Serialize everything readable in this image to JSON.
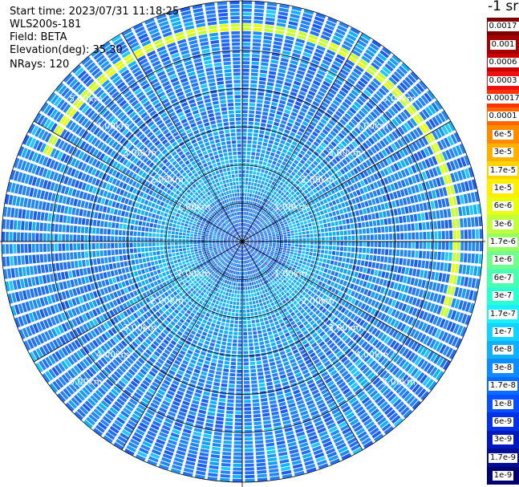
{
  "header": {
    "start_time": "Start time: 2023/07/31 11:18:25",
    "instrument": "WLS200s-181",
    "field": "Field: BETA",
    "elevation": "Elevation(deg): 35.30",
    "nrays": "NRays: 120"
  },
  "colorbar": {
    "unit_label": "-1 sr",
    "entries": [
      {
        "label": "0.0017",
        "color": "#7f0000"
      },
      {
        "label": "0.001",
        "color": "#a50000"
      },
      {
        "label": "0.0006",
        "color": "#cc0000"
      },
      {
        "label": "0.0003",
        "color": "#ee1111"
      },
      {
        "label": "0.00017",
        "color": "#ff3300"
      },
      {
        "label": "0.0001",
        "color": "#ff6600"
      },
      {
        "label": "6e-5",
        "color": "#ff8c00"
      },
      {
        "label": "3e-5",
        "color": "#ffb000"
      },
      {
        "label": "1.7e-5",
        "color": "#ffd400"
      },
      {
        "label": "1e-5",
        "color": "#ffee00"
      },
      {
        "label": "6e-6",
        "color": "#e8ff10"
      },
      {
        "label": "3e-6",
        "color": "#bfff3c"
      },
      {
        "label": "1.7e-6",
        "color": "#96ff64"
      },
      {
        "label": "1e-6",
        "color": "#70ff8c"
      },
      {
        "label": "6e-7",
        "color": "#4cffb0"
      },
      {
        "label": "3e-7",
        "color": "#2cffd0"
      },
      {
        "label": "1.7e-7",
        "color": "#18f0ff"
      },
      {
        "label": "1e-7",
        "color": "#14d4ff"
      },
      {
        "label": "6e-8",
        "color": "#10b0ff"
      },
      {
        "label": "3e-8",
        "color": "#0c8cff"
      },
      {
        "label": "1.7e-8",
        "color": "#0a6cff"
      },
      {
        "label": "1e-8",
        "color": "#0850ff"
      },
      {
        "label": "6e-9",
        "color": "#0432e6"
      },
      {
        "label": "3e-9",
        "color": "#0018c0"
      },
      {
        "label": "1.7e-9",
        "color": "#000d96"
      },
      {
        "label": "1e-9",
        "color": "#00006e"
      }
    ]
  },
  "chart_data": {
    "type": "heatmap",
    "projection": "polar PPI",
    "field": "BETA",
    "nrays": 120,
    "range_rings_km": [
      1.0,
      2.0,
      3.0,
      4.0,
      5.0
    ],
    "range_ring_labels": [
      "1.00km",
      "2.00km",
      "3.00km",
      "4.00km",
      "5.00km"
    ],
    "max_range_km": 6.3,
    "scale": "log",
    "value_range": [
      1e-09,
      0.0017
    ],
    "features": [
      {
        "description": "high-backscatter arc",
        "range_km": [
          5.5,
          5.7
        ],
        "azimuth_deg": [
          -90,
          20
        ],
        "value": 3e-06
      },
      {
        "description": "near-field cyan halo",
        "range_km": [
          1.1,
          2.3
        ],
        "value": 1.7e-07
      },
      {
        "description": "background",
        "range_km": [
          2.3,
          6.3
        ],
        "value": 2e-08
      }
    ]
  }
}
